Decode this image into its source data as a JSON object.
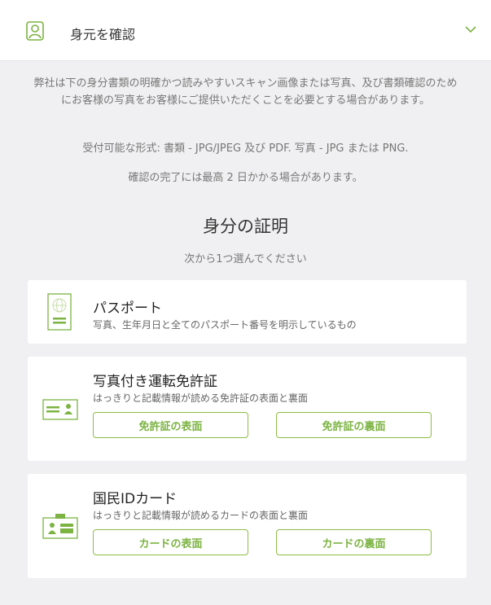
{
  "header": {
    "title": "身元を確認",
    "user_icon": "user-icon",
    "toggle_icon": "chevron-down-icon"
  },
  "intro": {
    "description": "弊社は下の身分書類の明確かつ読みやすいスキャン画像または写真、及び書類確認のためにお客様の写真をお客様にご提供いただくことを必要とする場合があります。",
    "formats": "受付可能な形式: 書類 - JPG/JPEG 及び PDF. 写真 - JPG または PNG.",
    "timing": "確認の完了には最高 2 日かかる場合があります。"
  },
  "section": {
    "title": "身分の証明",
    "subtitle": "次から1つ選んでください"
  },
  "documents": [
    {
      "title": "パスポート",
      "description": "写真、生年月日と全てのパスポート番号を明示しているもの",
      "icon": "passport-icon"
    },
    {
      "title": "写真付き運転免許証",
      "description": "はっきりと記載情報が読める免許証の表面と裏面",
      "icon": "driver-license-icon",
      "front_label": "免許証の表面",
      "back_label": "免許証の裏面"
    },
    {
      "title": "国民IDカード",
      "description": "はっきりと記載情報が読めるカードの表面と裏面",
      "icon": "id-card-icon",
      "front_label": "カードの表面",
      "back_label": "カードの裏面"
    }
  ],
  "colors": {
    "accent": "#7cb342",
    "background": "#f0f0f2",
    "card": "#ffffff"
  }
}
